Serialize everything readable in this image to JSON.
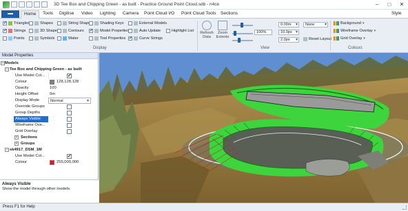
{
  "window": {
    "title": "3D Tee Box and Chipping Green - as built - Practice Ground Point Cloud.sdb - n4ce",
    "minimize": "–",
    "maximize": "□",
    "close": "✕"
  },
  "ribbon_tabs": [
    "Home",
    "Tools",
    "Digitise",
    "Video",
    "Lighting",
    "Camera",
    "Point Cloud I/O",
    "Point Cloud Tools",
    "Sections"
  ],
  "active_tab": "Home",
  "style_label": "Style",
  "display_group": {
    "label": "Display",
    "col1": [
      {
        "label": "Triangles",
        "checked": true
      },
      {
        "label": "Strings",
        "checked": true
      },
      {
        "label": "Points",
        "checked": false
      }
    ],
    "col2": [
      {
        "label": "Shapes",
        "checked": false
      },
      {
        "label": "3D Shapes",
        "checked": false
      },
      {
        "label": "Symbols",
        "checked": false
      }
    ],
    "col3": [
      {
        "label": "String Shapes",
        "checked": false
      },
      {
        "label": "Contours",
        "checked": false
      },
      {
        "label": "Water",
        "checked": false
      }
    ],
    "col4": [
      {
        "label": "Shading Keys",
        "checked": false
      },
      {
        "label": "Model Properties",
        "checked": true
      },
      {
        "label": "Tool Properties",
        "checked": false
      }
    ],
    "col5": [
      {
        "label": "External Models",
        "checked": false
      },
      {
        "label": "Auto Update",
        "checked": false
      },
      {
        "label": "Curve Strings",
        "checked": true
      }
    ],
    "col6": [
      {
        "label": "Highlight List",
        "checked": false
      }
    ]
  },
  "view_group": {
    "label": "View",
    "refresh_label": "Refresh Data",
    "zoom_extents_label": "Zoom Extents",
    "zoom_value": "100%",
    "spin1": "0.00m",
    "spin2": "10.0px",
    "spin3": "2.0px",
    "none_dropdown": "None",
    "reset_layout": "Reset Layout"
  },
  "colours_group": {
    "label": "Colours",
    "items": [
      "Background",
      "Wireframe Overlay",
      "Grid Overlay"
    ]
  },
  "panel": {
    "title": "Model Properties",
    "models_label": "Models",
    "model1": {
      "name": "Tee Box and Chipping Green - as built",
      "rows": [
        {
          "label": "Use Model Col...",
          "type": "check",
          "checked": true
        },
        {
          "label": "Colour",
          "type": "colour",
          "value": "128,128,128",
          "color": "#808080"
        },
        {
          "label": "Opacity",
          "type": "text",
          "value": "100"
        },
        {
          "label": "Height Offset",
          "type": "text",
          "value": "0m"
        },
        {
          "label": "Display Mode",
          "type": "dropdown",
          "value": "Normal"
        },
        {
          "label": "Override Groups",
          "type": "check",
          "checked": false
        },
        {
          "label": "Group Depths",
          "type": "check",
          "checked": false
        },
        {
          "label": "Always Visible",
          "type": "check",
          "checked": false,
          "selected": true
        },
        {
          "label": "Wireframe Ove...",
          "type": "check",
          "checked": false
        },
        {
          "label": "Grid Overlay",
          "type": "check",
          "checked": false
        }
      ],
      "sections_label": "Sections",
      "groups_label": "Groups"
    },
    "model2": {
      "name": "sk4917_DSM_1M",
      "rows": [
        {
          "label": "Use Model Col...",
          "type": "check",
          "checked": true
        },
        {
          "label": "Colour",
          "type": "colour",
          "value": "255,000,000",
          "color": "#e8141e"
        }
      ]
    },
    "help_title": "Always Visible",
    "help_text": "Show the model through other models."
  },
  "status": {
    "text": "Press F1 for Help"
  },
  "colors": {
    "accent": "#1f5ea8",
    "green_outline": "#2ee62e",
    "sky": "#5f8fd0",
    "terrain_brown": "#9b7a3e"
  }
}
